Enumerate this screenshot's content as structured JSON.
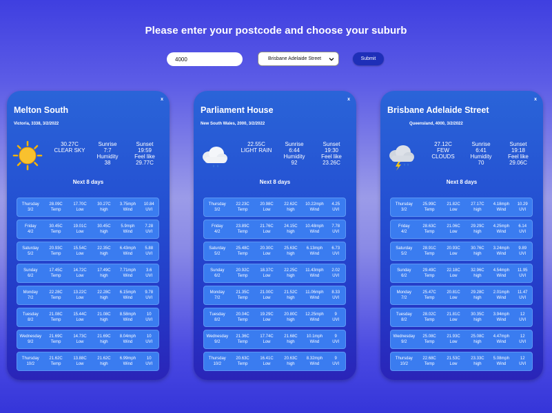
{
  "page_title": "Please enter your postcode and choose your suburb",
  "form": {
    "postcode_value": "4000",
    "suburb_selected": "Brisbane Adelaide Street",
    "submit_label": "Submit"
  },
  "cards": [
    {
      "close": "x",
      "city": "Melton South",
      "subtitle": "Victoria, 3338, 3/2/2022",
      "icon": "sun-icon",
      "temp": "30.27C",
      "desc1": "CLEAR SKY",
      "desc2": "",
      "sunrise_label": "Sunrise",
      "sunrise": "7:7",
      "humidity_label": "Humidity",
      "humidity": "38",
      "sunset_label": "Sunset",
      "sunset": "19:59",
      "feel_label": "Feel like",
      "feel": "29.77C",
      "next_label": "Next 8 days",
      "rows": [
        {
          "day": "Thursday",
          "date": "3/2",
          "temp": "28.09C",
          "low": "17.70C",
          "high": "30.27C",
          "wind": "3.75mph",
          "uvi": "10.84"
        },
        {
          "day": "Friday",
          "date": "4/2",
          "temp": "30.45C",
          "low": "19.01C",
          "high": "30.45C",
          "wind": "5.9mph",
          "uvi": "7.28"
        },
        {
          "day": "Saturday",
          "date": "5/2",
          "temp": "20.93C",
          "low": "15.54C",
          "high": "22.35C",
          "wind": "6.43mph",
          "uvi": "5.88"
        },
        {
          "day": "Sunday",
          "date": "6/2",
          "temp": "17.45C",
          "low": "14.72C",
          "high": "17.49C",
          "wind": "7.71mph",
          "uvi": "3.6"
        },
        {
          "day": "Monday",
          "date": "7/2",
          "temp": "22.28C",
          "low": "13.22C",
          "high": "22.28C",
          "wind": "6.15mph",
          "uvi": "9.78"
        },
        {
          "day": "Tuesday",
          "date": "8/2",
          "temp": "21.08C",
          "low": "15.44C",
          "high": "21.08C",
          "wind": "8.58mph",
          "uvi": "10"
        },
        {
          "day": "Wednesday",
          "date": "9/2",
          "temp": "21.69C",
          "low": "14.73C",
          "high": "21.69C",
          "wind": "8.04mph",
          "uvi": "10"
        },
        {
          "day": "Thursday",
          "date": "10/2",
          "temp": "21.62C",
          "low": "13.88C",
          "high": "21.62C",
          "wind": "6.99mph",
          "uvi": "10"
        }
      ]
    },
    {
      "close": "x",
      "city": "Parliament House",
      "subtitle": "New South Wales, 2000, 3/2/2022",
      "icon": "rain-cloud-icon",
      "temp": "22.55C",
      "desc1": "LIGHT RAIN",
      "desc2": "",
      "sunrise_label": "Sunrise",
      "sunrise": "6:44",
      "humidity_label": "Humidity",
      "humidity": "92",
      "sunset_label": "Sunset",
      "sunset": "19:30",
      "feel_label": "Feel like",
      "feel": "23.26C",
      "next_label": "Next 8 days",
      "rows": [
        {
          "day": "Thursday",
          "date": "3/2",
          "temp": "22.23C",
          "low": "20.98C",
          "high": "22.62C",
          "wind": "10.22mph",
          "uvi": "4.25"
        },
        {
          "day": "Friday",
          "date": "4/2",
          "temp": "23.89C",
          "low": "21.76C",
          "high": "24.15C",
          "wind": "10.48mph",
          "uvi": "7.78"
        },
        {
          "day": "Saturday",
          "date": "5/2",
          "temp": "25.48C",
          "low": "20.30C",
          "high": "25.63C",
          "wind": "6.13mph",
          "uvi": "6.73"
        },
        {
          "day": "Sunday",
          "date": "6/2",
          "temp": "20.92C",
          "low": "18.37C",
          "high": "22.25C",
          "wind": "11.43mph",
          "uvi": "2.02"
        },
        {
          "day": "Monday",
          "date": "7/2",
          "temp": "21.35C",
          "low": "21.00C",
          "high": "21.52C",
          "wind": "11.06mph",
          "uvi": "8.33"
        },
        {
          "day": "Tuesday",
          "date": "8/2",
          "temp": "20.04C",
          "low": "19.29C",
          "high": "20.80C",
          "wind": "12.25mph",
          "uvi": "9"
        },
        {
          "day": "Wednesday",
          "date": "9/2",
          "temp": "21.36C",
          "low": "17.74C",
          "high": "21.68C",
          "wind": "10.1mph",
          "uvi": "9"
        },
        {
          "day": "Thursday",
          "date": "10/2",
          "temp": "20.63C",
          "low": "16.41C",
          "high": "20.63C",
          "wind": "8.32mph",
          "uvi": "9"
        }
      ]
    },
    {
      "close": "x",
      "city": "Brisbane Adelaide Street",
      "subtitle": "Queensland, 4000, 3/2/2022",
      "icon": "storm-cloud-icon",
      "temp": "27.12C",
      "desc1": "FEW",
      "desc2": "CLOUDS",
      "sunrise_label": "Sunrise",
      "sunrise": "6:41",
      "humidity_label": "Humidity",
      "humidity": "70",
      "sunset_label": "Sunset",
      "sunset": "19:18",
      "feel_label": "Feel like",
      "feel": "29.06C",
      "next_label": "Next 8 days",
      "rows": [
        {
          "day": "Thursday",
          "date": "3/2",
          "temp": "25.99C",
          "low": "21.82C",
          "high": "27.17C",
          "wind": "4.18mph",
          "uvi": "10.29"
        },
        {
          "day": "Friday",
          "date": "4/2",
          "temp": "28.63C",
          "low": "21.06C",
          "high": "29.29C",
          "wind": "4.25mph",
          "uvi": "6.14"
        },
        {
          "day": "Saturday",
          "date": "5/2",
          "temp": "28.91C",
          "low": "20.93C",
          "high": "30.76C",
          "wind": "3.24mph",
          "uvi": "9.89"
        },
        {
          "day": "Sunday",
          "date": "6/2",
          "temp": "29.49C",
          "low": "22.18C",
          "high": "32.96C",
          "wind": "4.54mph",
          "uvi": "11.95"
        },
        {
          "day": "Monday",
          "date": "7/2",
          "temp": "25.47C",
          "low": "20.81C",
          "high": "29.28C",
          "wind": "2.01mph",
          "uvi": "11.47"
        },
        {
          "day": "Tuesday",
          "date": "8/2",
          "temp": "28.02C",
          "low": "21.81C",
          "high": "30.35C",
          "wind": "3.94mph",
          "uvi": "12"
        },
        {
          "day": "Wednesday",
          "date": "9/2",
          "temp": "25.08C",
          "low": "21.93C",
          "high": "25.08C",
          "wind": "4.47mph",
          "uvi": "12"
        },
        {
          "day": "Thursday",
          "date": "10/2",
          "temp": "22.68C",
          "low": "21.53C",
          "high": "23.33C",
          "wind": "5.08mph",
          "uvi": "12"
        }
      ]
    }
  ],
  "row_labels": {
    "temp": "Temp",
    "low": "Low",
    "high": "high",
    "wind": "Wind",
    "uvi": "UVI"
  }
}
